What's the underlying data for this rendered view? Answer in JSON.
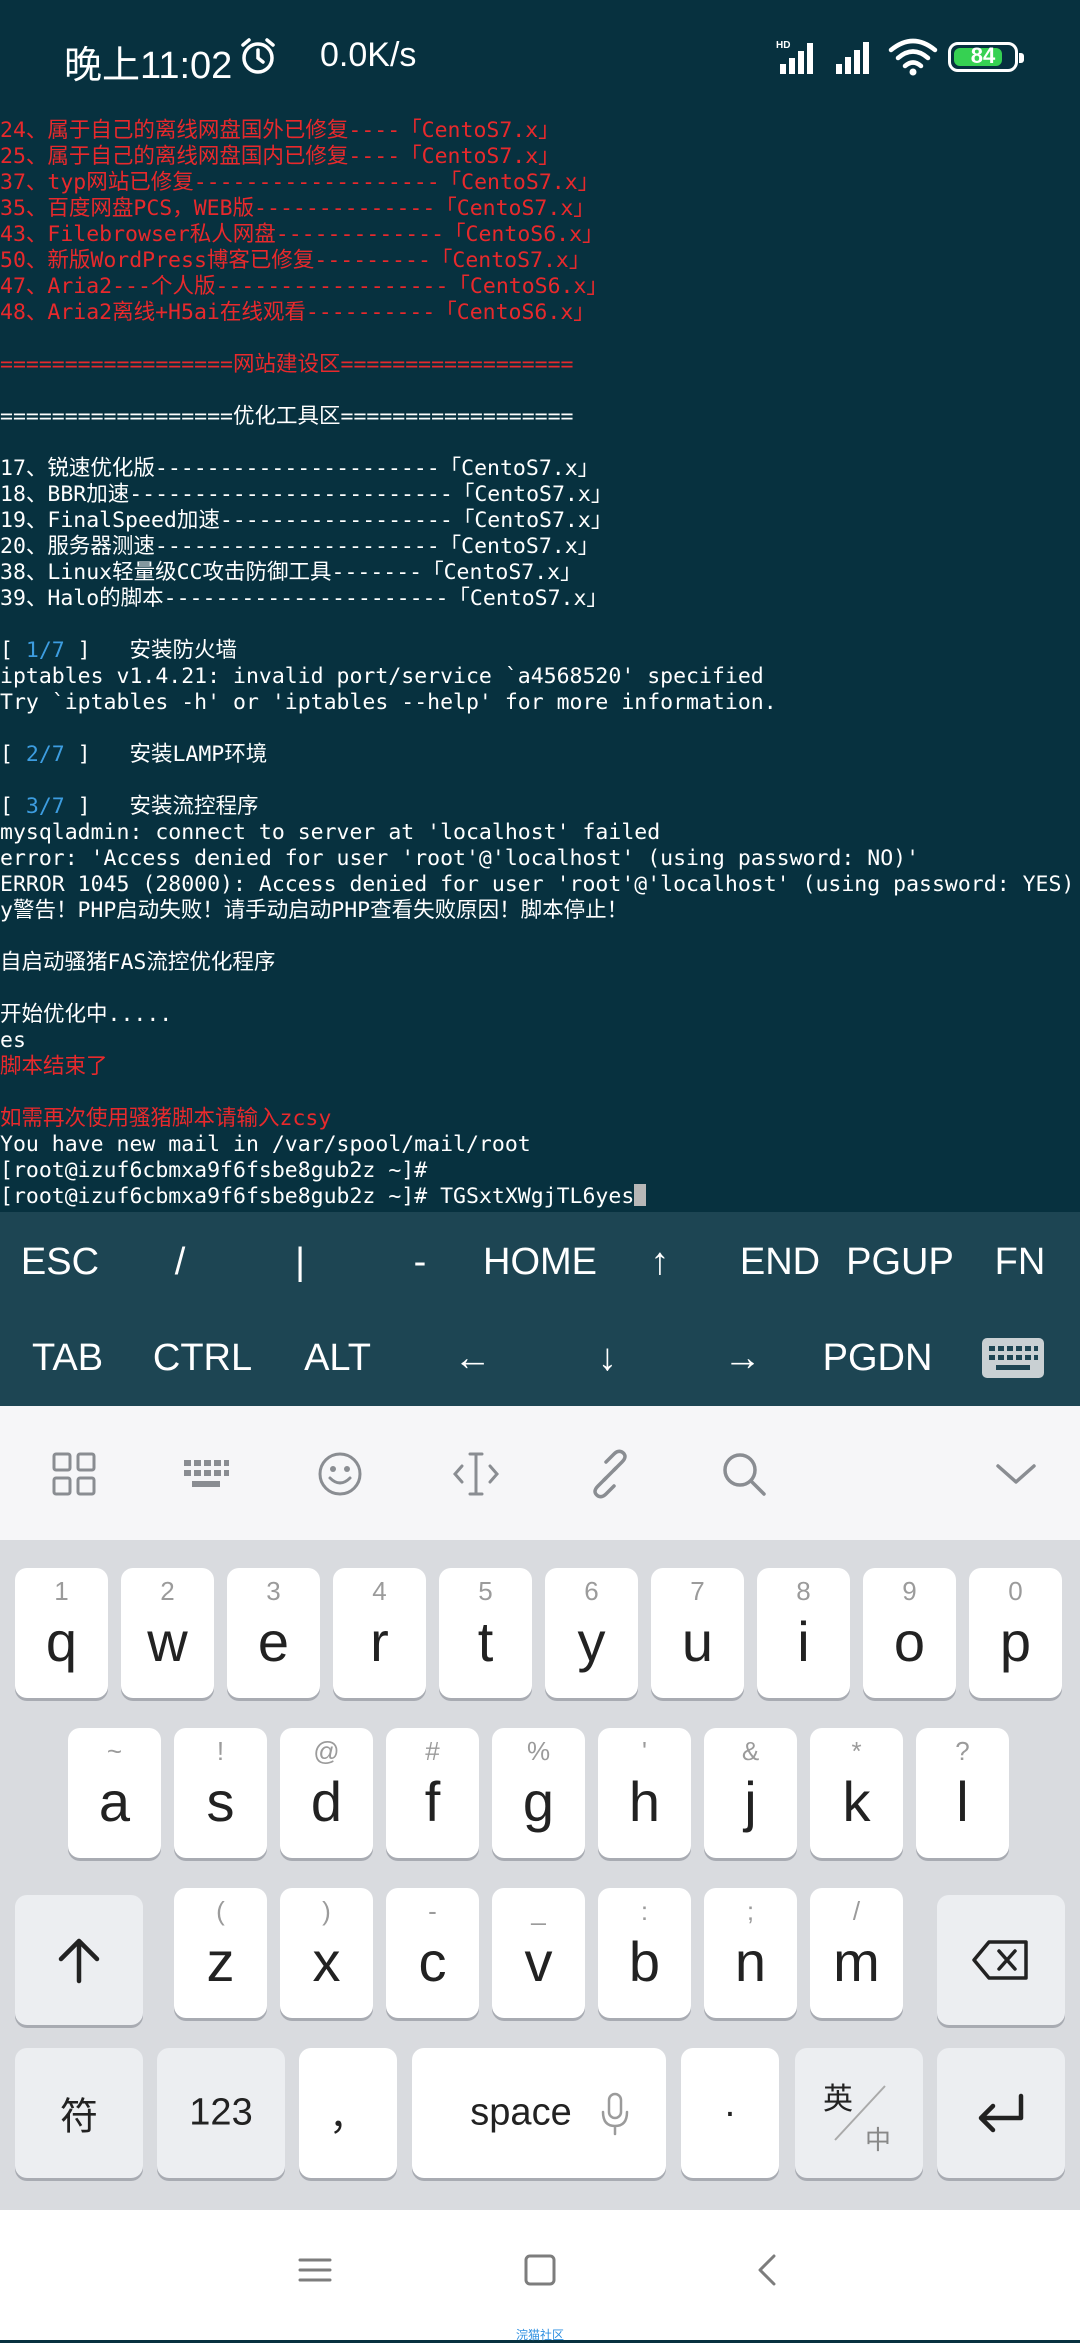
{
  "status_bar": {
    "time": "晚上11:02",
    "net_speed": "0.0K/s",
    "battery_level": "84",
    "battery_color": "#36d152",
    "icons": [
      "alarm-icon",
      "hd-signal-icon",
      "signal-icon",
      "wifi-icon",
      "battery-icon"
    ]
  },
  "terminal": {
    "lines": [
      {
        "text": "24、属于自己的离线网盘国外已修复----「CentoS7.x」",
        "color": "red"
      },
      {
        "text": "25、属于自己的离线网盘国内已修复----「CentoS7.x」",
        "color": "red"
      },
      {
        "text": "37、typ网站已修复-------------------「CentoS7.x」",
        "color": "red"
      },
      {
        "text": "35、百度网盘PCS，WEB版--------------「CentoS7.x」",
        "color": "red"
      },
      {
        "text": "43、Filebrowser私人网盘-------------「CentoS6.x」",
        "color": "red"
      },
      {
        "text": "50、新版WordPress博客已修复---------「CentoS7.x」",
        "color": "red"
      },
      {
        "text": "47、Aria2---个人版------------------「CentoS6.x」",
        "color": "red"
      },
      {
        "text": "48、Aria2离线+H5ai在线观看----------「CentoS6.x」",
        "color": "red"
      },
      {
        "text": "",
        "color": "white"
      },
      {
        "text": "==================网站建设区==================",
        "color": "red"
      },
      {
        "text": "",
        "color": "white"
      },
      {
        "text": "==================优化工具区==================",
        "color": "white"
      },
      {
        "text": "",
        "color": "white"
      },
      {
        "text": "17、锐速优化版----------------------「CentoS7.x」",
        "color": "white"
      },
      {
        "text": "18、BBR加速-------------------------「CentoS7.x」",
        "color": "white"
      },
      {
        "text": "19、FinalSpeed加速------------------「CentoS7.x」",
        "color": "white"
      },
      {
        "text": "20、服务器测速----------------------「CentoS7.x」",
        "color": "white"
      },
      {
        "text": "38、Linux轻量级CC攻击防御工具-------「CentoS7.x」",
        "color": "white"
      },
      {
        "text": "39、Halo的脚本----------------------「CentoS7.x」",
        "color": "white"
      },
      {
        "text": "",
        "color": "white"
      },
      {
        "text": "[ ",
        "step": "1/7",
        "after": " ]   安装防火墙",
        "color": "white"
      },
      {
        "text": "iptables v1.4.21: invalid port/service `a4568520' specified",
        "color": "white"
      },
      {
        "text": "Try `iptables -h' or 'iptables --help' for more information.",
        "color": "white"
      },
      {
        "text": "",
        "color": "white"
      },
      {
        "text": "[ ",
        "step": "2/7",
        "after": " ]   安装LAMP环境",
        "color": "white"
      },
      {
        "text": "",
        "color": "white"
      },
      {
        "text": "[ ",
        "step": "3/7",
        "after": " ]   安装流控程序",
        "color": "white"
      },
      {
        "text": "mysqladmin: connect to server at 'localhost' failed",
        "color": "white"
      },
      {
        "text": "error: 'Access denied for user 'root'@'localhost' (using password: NO)'",
        "color": "white"
      },
      {
        "text": "ERROR 1045 (28000): Access denied for user 'root'@'localhost' (using password: YES)",
        "color": "white"
      },
      {
        "text": "y警告！PHP启动失败！请手动启动PHP查看失败原因！脚本停止！",
        "color": "white"
      },
      {
        "text": "",
        "color": "white"
      },
      {
        "text": "自启动骚猪FAS流控优化程序",
        "color": "white"
      },
      {
        "text": "",
        "color": "white"
      },
      {
        "text": "开始优化中.....",
        "color": "white"
      },
      {
        "text": "es",
        "color": "white"
      },
      {
        "text": "脚本结束了",
        "color": "red"
      },
      {
        "text": "",
        "color": "white"
      },
      {
        "text": "如需再次使用骚猪脚本请输入zcsy",
        "color": "red"
      },
      {
        "text": "You have new mail in /var/spool/mail/root",
        "color": "white"
      },
      {
        "text": "[root@izuf6cbmxa9f6fsbe8gub2z ~]#",
        "color": "white"
      },
      {
        "text": "[root@izuf6cbmxa9f6fsbe8gub2z ~]# TGSxtXWgjTL6yes",
        "color": "white",
        "cursor": true
      }
    ]
  },
  "extra_keys": {
    "row1": [
      "ESC",
      "/",
      "|",
      "-",
      "HOME",
      "↑",
      "END",
      "PGUP",
      "FN"
    ],
    "row2": [
      "TAB",
      "CTRL",
      "ALT",
      "←",
      "↓",
      "→",
      "PGDN"
    ]
  },
  "keyboard": {
    "row1": [
      {
        "hint": "1",
        "key": "q"
      },
      {
        "hint": "2",
        "key": "w"
      },
      {
        "hint": "3",
        "key": "e"
      },
      {
        "hint": "4",
        "key": "r"
      },
      {
        "hint": "5",
        "key": "t"
      },
      {
        "hint": "6",
        "key": "y"
      },
      {
        "hint": "7",
        "key": "u"
      },
      {
        "hint": "8",
        "key": "i"
      },
      {
        "hint": "9",
        "key": "o"
      },
      {
        "hint": "0",
        "key": "p"
      }
    ],
    "row2": [
      {
        "hint": "~",
        "key": "a"
      },
      {
        "hint": "!",
        "key": "s"
      },
      {
        "hint": "@",
        "key": "d"
      },
      {
        "hint": "#",
        "key": "f"
      },
      {
        "hint": "%",
        "key": "g"
      },
      {
        "hint": "'",
        "key": "h"
      },
      {
        "hint": "&",
        "key": "j"
      },
      {
        "hint": "*",
        "key": "k"
      },
      {
        "hint": "?",
        "key": "l"
      }
    ],
    "row3": [
      {
        "hint": "(",
        "key": "z"
      },
      {
        "hint": ")",
        "key": "x"
      },
      {
        "hint": "-",
        "key": "c"
      },
      {
        "hint": "_",
        "key": "v"
      },
      {
        "hint": ":",
        "key": "b"
      },
      {
        "hint": ";",
        "key": "n"
      },
      {
        "hint": "/",
        "key": "m"
      }
    ],
    "symbols_label": "符",
    "numbers_label": "123",
    "comma_label": "，",
    "space_label": "space",
    "period_label": "·",
    "lang_top": "英",
    "lang_bottom": "中"
  },
  "watermark": "浣猫社区"
}
